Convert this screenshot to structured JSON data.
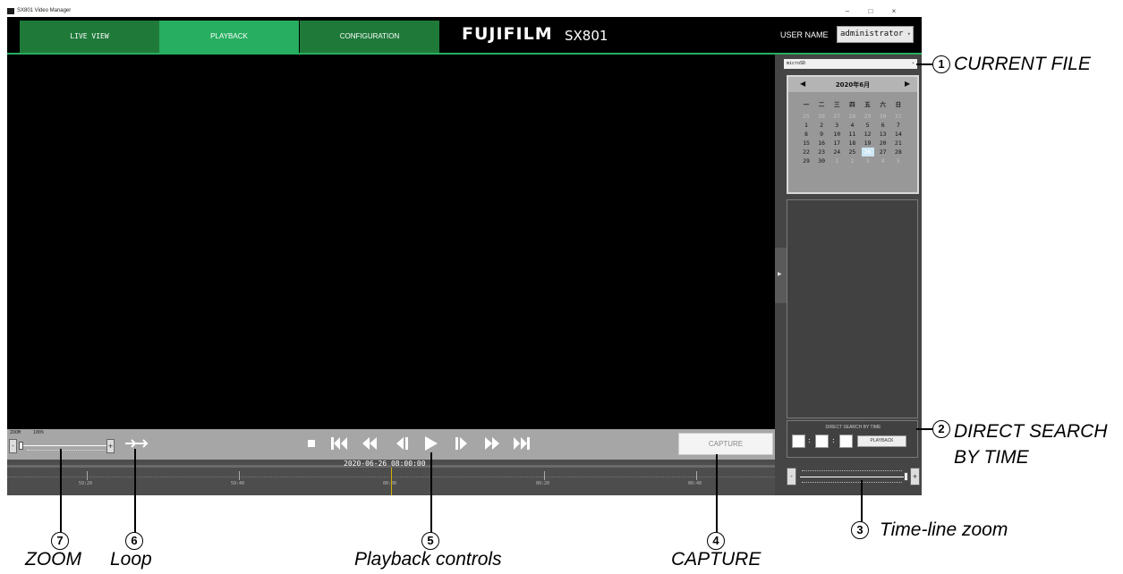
{
  "window": {
    "title": "SX801 Video Manager",
    "minimize": "–",
    "maximize": "□",
    "close": "×"
  },
  "header": {
    "tabs": [
      "LIVE VIEW",
      "PLAYBACK",
      "CONFIGURATION"
    ],
    "active_tab": "PLAYBACK",
    "brand": "FUJIFILM",
    "model": "SX801",
    "user_label": "USER NAME",
    "user_value": "administrator",
    "accent_color": "#27ae60"
  },
  "zoom": {
    "label": "ZOOM",
    "value": "100%",
    "minus": "-",
    "plus": "+"
  },
  "playback": {
    "buttons": [
      "stop-icon",
      "skip-to-start-icon",
      "rewind-icon",
      "step-back-icon",
      "play-icon",
      "step-forward-icon",
      "fast-forward-icon",
      "skip-to-end-icon"
    ],
    "capture_label": "CAPTURE"
  },
  "timeline": {
    "current": "2020-06-26 08:00:00",
    "tick_labels": [
      "59:20",
      "59:40",
      "00:00",
      "00:20",
      "00:40"
    ]
  },
  "right_panel": {
    "storage": "microSD",
    "calendar": {
      "title": "2020年6月",
      "prev": "◀",
      "next": "▶",
      "weekdays": [
        "一",
        "二",
        "三",
        "四",
        "五",
        "六",
        "日"
      ],
      "weeks": [
        [
          "25",
          "26",
          "27",
          "28",
          "29",
          "30",
          "31"
        ],
        [
          "1",
          "2",
          "3",
          "4",
          "5",
          "6",
          "7"
        ],
        [
          "8",
          "9",
          "10",
          "11",
          "12",
          "13",
          "14"
        ],
        [
          "15",
          "16",
          "17",
          "18",
          "19",
          "20",
          "21"
        ],
        [
          "22",
          "23",
          "24",
          "25",
          "26",
          "27",
          "28"
        ],
        [
          "29",
          "30",
          "1",
          "2",
          "3",
          "4",
          "5"
        ]
      ],
      "selected": "26"
    },
    "direct_search": {
      "label": "DIRECT SEARCH BY TIME",
      "hour": "",
      "minute": "",
      "second": "",
      "button": "PLAYBACK"
    },
    "timeline_zoom": {
      "minus": "-",
      "plus": "+"
    }
  },
  "callouts": [
    {
      "number": "1",
      "text": "CURRENT FILE"
    },
    {
      "number": "2",
      "text": "DIRECT SEARCH BY TIME"
    },
    {
      "number": "3",
      "text": "Time-line zoom"
    },
    {
      "number": "4",
      "text": "CAPTURE"
    },
    {
      "number": "5",
      "text": "Playback controls"
    },
    {
      "number": "6",
      "text": "Loop"
    },
    {
      "number": "7",
      "text": "ZOOM"
    }
  ]
}
